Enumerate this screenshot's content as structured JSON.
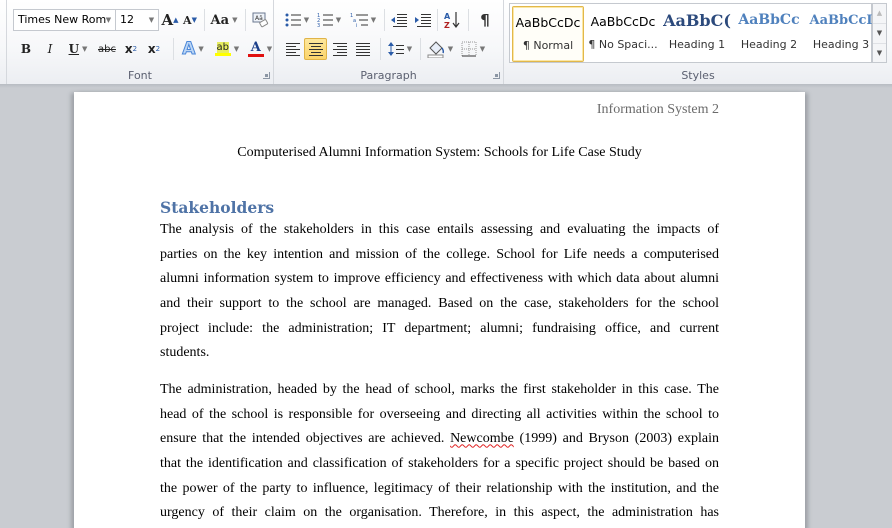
{
  "ribbon": {
    "font_group": {
      "label": "Font",
      "font_name": "Times New Rom",
      "font_size": "12",
      "grow_font": "A",
      "shrink_font": "A",
      "change_case": "Aa",
      "bold": "B",
      "italic": "I",
      "underline": "U",
      "strikethrough": "abc",
      "subscript": "x",
      "superscript": "x",
      "text_effects": "A",
      "highlight": "ab",
      "font_color": "A",
      "highlight_color": "#ffff00",
      "font_color_value": "#e01010"
    },
    "paragraph_group": {
      "label": "Paragraph",
      "sort": "A Z",
      "show_marks": "¶",
      "active_alignment": "center"
    },
    "styles_group": {
      "label": "Styles",
      "items": [
        {
          "sample": "AaBbCcDc",
          "name": "¶ Normal",
          "active": true
        },
        {
          "sample": "AaBbCcDc",
          "name": "¶ No Spaci...",
          "active": false
        },
        {
          "sample": "AaBbC(",
          "name": "Heading 1",
          "active": false
        },
        {
          "sample": "AaBbCc",
          "name": "Heading 2",
          "active": false
        },
        {
          "sample": "AaBbCcI",
          "name": "Heading 3",
          "active": false
        }
      ]
    }
  },
  "document": {
    "header": "Information System 2",
    "title": "Computerised Alumni Information System: Schools for Life Case Study",
    "heading": "Stakeholders",
    "heading_color": "#4f73a6",
    "paragraph1": [
      "The analysis of the stakeholders in this case entails assessing and evaluating the impacts of",
      "parties on the key intention and mission of the college. School for Life needs a computerised",
      "alumni information system to improve efficiency and effectiveness with which data about alumni",
      "and their support to the school are managed. Based on the case, stakeholders for the school",
      "project include: the administration; IT department; alumni; fundraising office, and current",
      "students."
    ],
    "paragraph2": {
      "line1": "The administration, headed by the head of school, marks the first stakeholder in this case. The",
      "line2": "head of the school is responsible for overseeing and directing all activities within the school to",
      "line3_before": "ensure that the intended objectives are achieved. ",
      "line3_misspelled": "Newcombe",
      "line3_after": " (1999) and Bryson (2003) explain",
      "line4": "that the identification and classification of stakeholders for a specific project should be based on",
      "line5": "the power of the party to influence, legitimacy of their relationship with the institution, and the",
      "line6": "urgency of their claim on the organisation. Therefore, in this aspect, the administration has"
    }
  }
}
